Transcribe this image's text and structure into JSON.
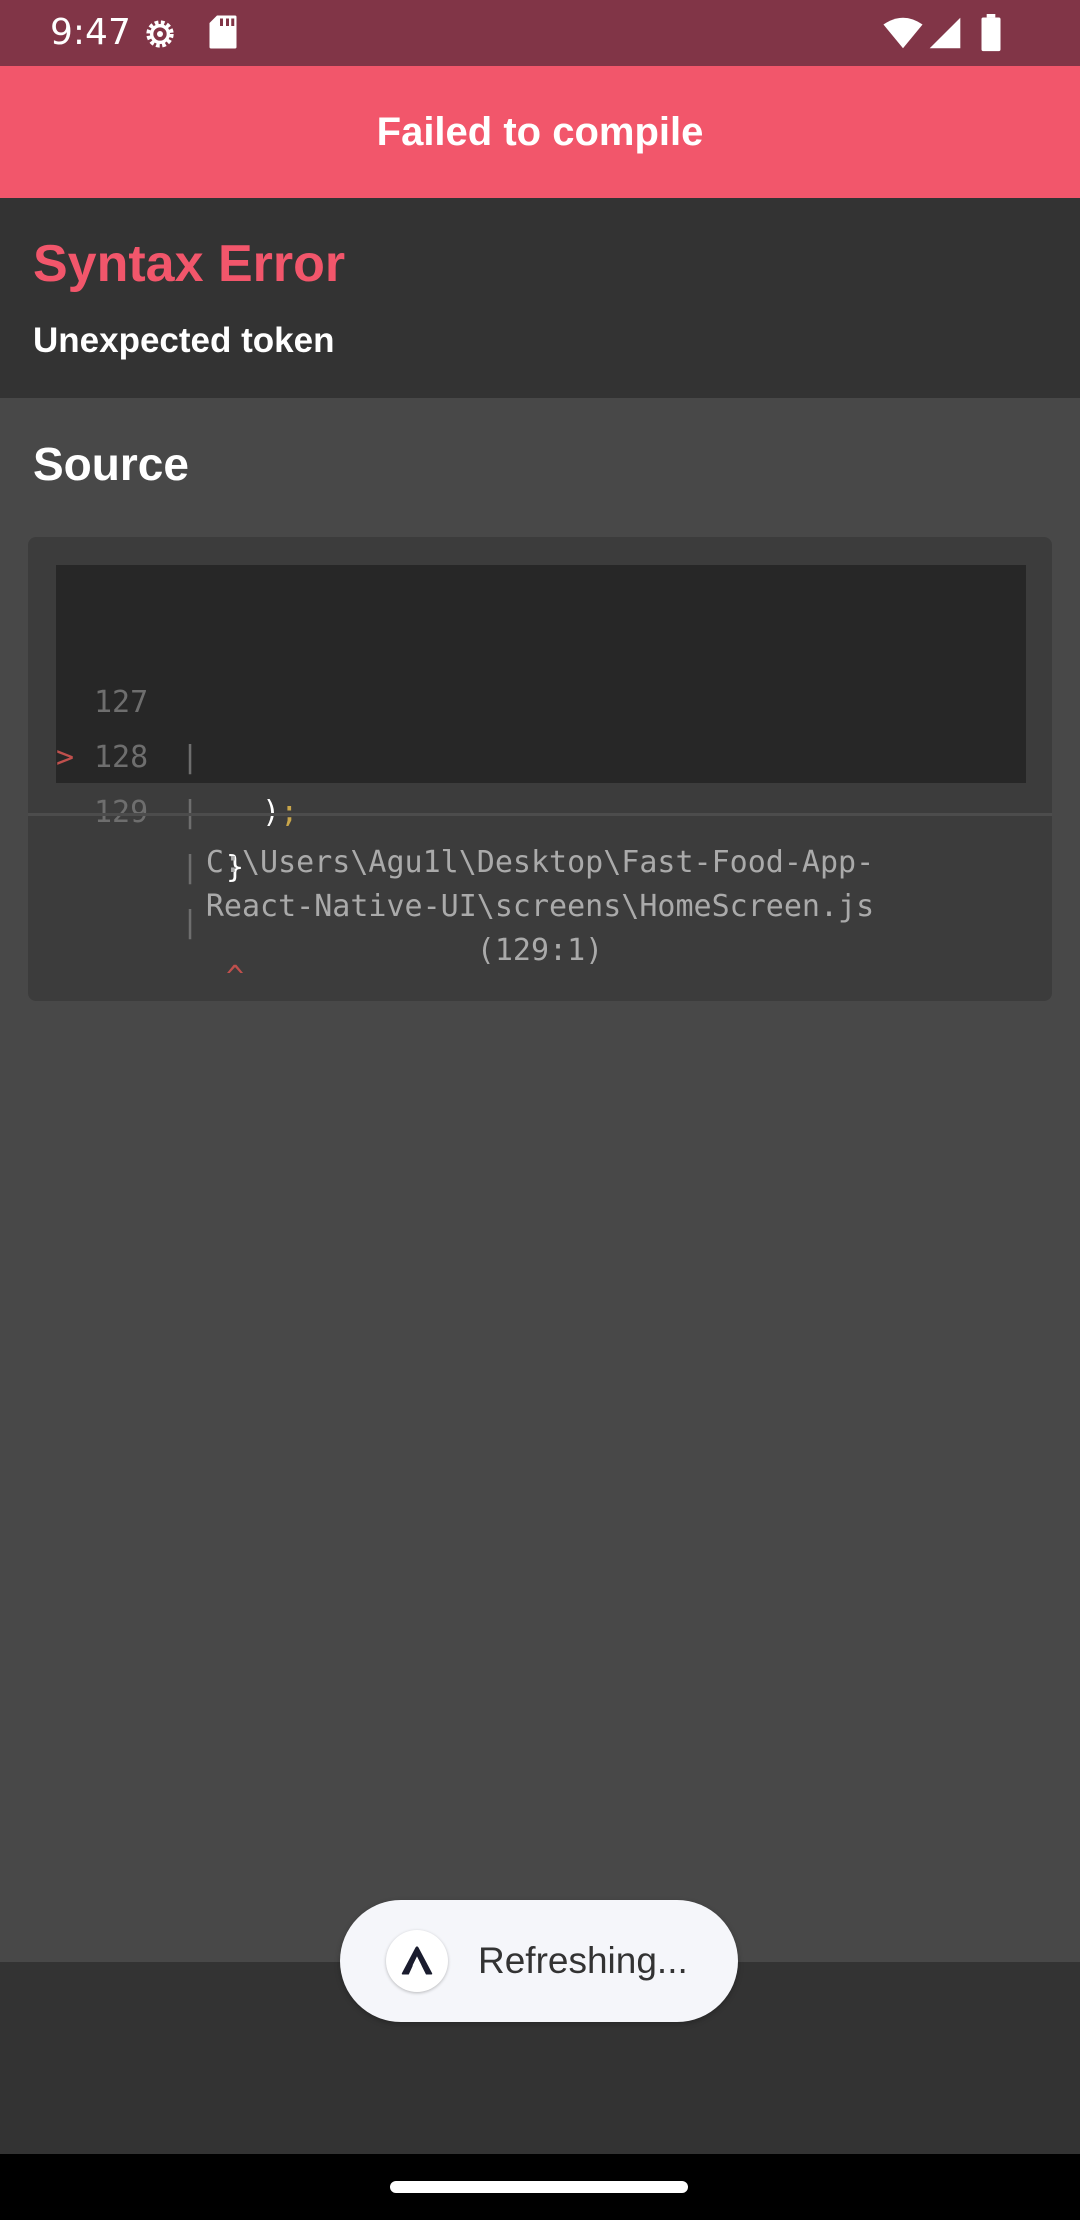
{
  "status_bar": {
    "time": "9:47",
    "icons": [
      "settings-gear-icon",
      "sd-card-icon",
      "wifi-icon",
      "cell-signal-icon",
      "battery-icon"
    ]
  },
  "header": {
    "title": "Failed to compile"
  },
  "error": {
    "title": "Syntax Error",
    "message": "Unexpected token"
  },
  "source": {
    "heading": "Source",
    "lines": [
      {
        "marker": "",
        "number": "127",
        "pipe": "|",
        "code": "  )",
        "suffix": ";"
      },
      {
        "marker": "",
        "number": "128",
        "pipe": "|",
        "code": "}",
        "suffix": ""
      },
      {
        "marker": ">",
        "number": "129",
        "pipe": "|",
        "code": "",
        "suffix": ""
      },
      {
        "marker": "",
        "number": "",
        "pipe": "|",
        "code": "",
        "suffix": "^"
      }
    ],
    "file_path_line1": "C:\\Users\\Agu1l\\Desktop\\Fast-Food-App-",
    "file_path_line2": "React-Native-UI\\screens\\HomeScreen.js",
    "file_path_line3": "(129:1)"
  },
  "toast": {
    "text": "Refreshing...",
    "icon": "expo-logo-icon"
  },
  "colors": {
    "status_bar": "#813547",
    "header": "#f2566b",
    "error_title": "#f2566b",
    "background": "#484848",
    "error_block": "#333333",
    "code_background": "#272727"
  }
}
